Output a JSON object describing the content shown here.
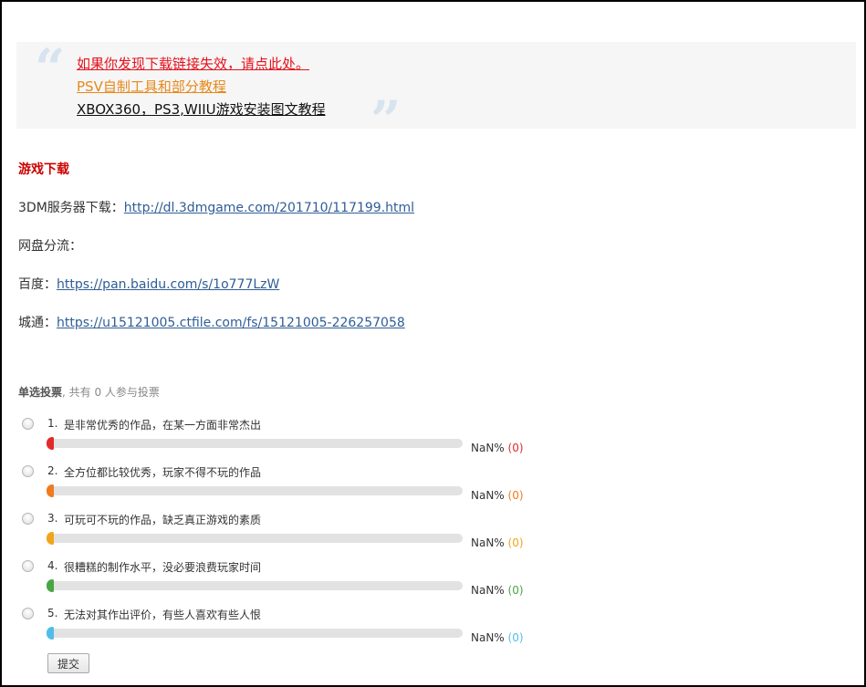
{
  "notice": {
    "items": [
      {
        "text": "如果你发现下载链接失效，请点此处。",
        "color": "#e5111b"
      },
      {
        "text": "PSV自制工具和部分教程",
        "color": "#e6891a"
      },
      {
        "text": "XBOX360，PS3,WIIU游戏安装图文教程",
        "color": "#111111"
      }
    ],
    "open_quote_icon": "open-quote-icon",
    "close_quote_icon": "close-quote-icon"
  },
  "download": {
    "title": "游戏下载",
    "lines": [
      {
        "label": "3DM服务器下载：",
        "link": "http://dl.3dmgame.com/201710/117199.html"
      },
      {
        "label": "网盘分流：",
        "link": ""
      },
      {
        "label": "百度：",
        "link": "https://pan.baidu.com/s/1o777LzW"
      },
      {
        "label": "城通：",
        "link": "https://u15121005.ctfile.com/fs/15121005-226257058"
      }
    ]
  },
  "poll": {
    "type_label": "单选投票",
    "participants_text": ", 共有 0 人参与投票",
    "options": [
      {
        "num": "1.",
        "label": "是非常优秀的作品，在某一方面非常杰出",
        "percent": "NaN%",
        "count": "(0)",
        "color": "#e22a2a"
      },
      {
        "num": "2.",
        "label": "全方位都比较优秀，玩家不得不玩的作品",
        "percent": "NaN%",
        "count": "(0)",
        "color": "#f07a1c"
      },
      {
        "num": "3.",
        "label": "可玩可不玩的作品，缺乏真正游戏的素质",
        "percent": "NaN%",
        "count": "(0)",
        "color": "#f2a41c"
      },
      {
        "num": "4.",
        "label": "很糟糕的制作水平，没必要浪费玩家时间",
        "percent": "NaN%",
        "count": "(0)",
        "color": "#4aa544"
      },
      {
        "num": "5.",
        "label": "无法对其作出评价，有些人喜欢有些人恨",
        "percent": "NaN%",
        "count": "(0)",
        "color": "#4fbde8"
      }
    ],
    "submit_label": "提交"
  }
}
